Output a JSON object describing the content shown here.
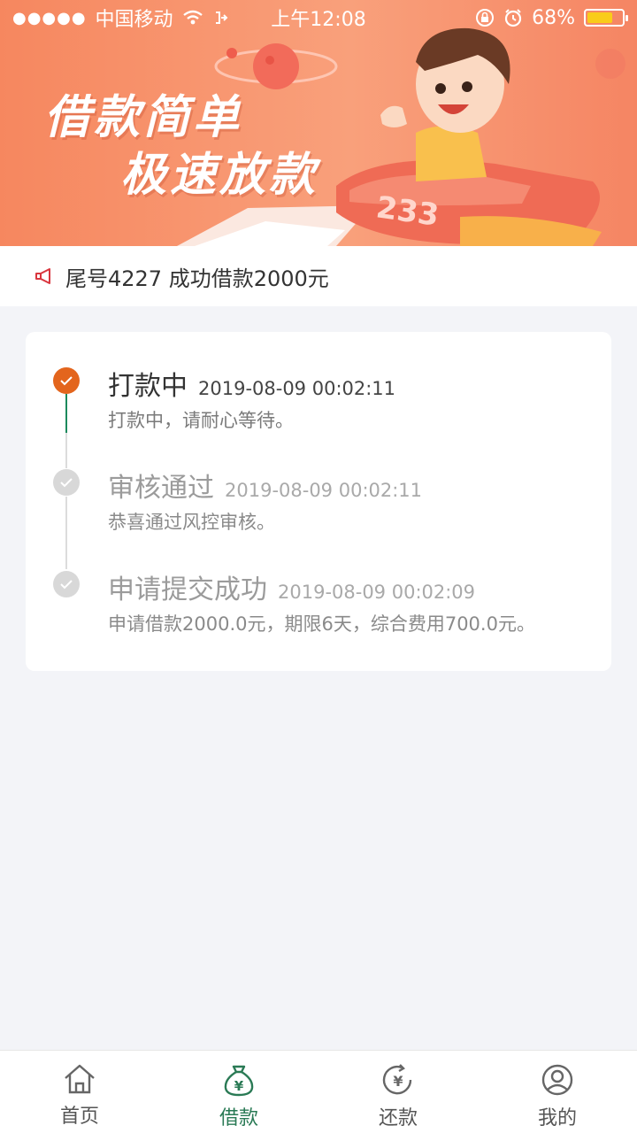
{
  "status_bar": {
    "signal": "●●●●●",
    "carrier": "中国移动",
    "time": "上午12:08",
    "battery": "68%"
  },
  "banner": {
    "line1": "借款简单",
    "line2": "极速放款",
    "plane_number": "233"
  },
  "notice": {
    "text": "尾号4227 成功借款2000元"
  },
  "steps": [
    {
      "title": "打款中",
      "time": "2019-08-09 00:02:11",
      "desc": "打款中，请耐心等待。",
      "state": "active"
    },
    {
      "title": "审核通过",
      "time": "2019-08-09 00:02:11",
      "desc": "恭喜通过风控审核。",
      "state": "done"
    },
    {
      "title": "申请提交成功",
      "time": "2019-08-09 00:02:09",
      "desc": "申请借款2000.0元，期限6天，综合费用700.0元。",
      "state": "done"
    }
  ],
  "tabs": [
    {
      "label": "首页",
      "icon": "home-icon"
    },
    {
      "label": "借款",
      "icon": "money-bag-icon",
      "active": true
    },
    {
      "label": "还款",
      "icon": "repay-icon"
    },
    {
      "label": "我的",
      "icon": "user-icon"
    }
  ],
  "colors": {
    "accent_orange": "#e3651d",
    "accent_green": "#2a7a55",
    "banner": "#f6875f"
  }
}
